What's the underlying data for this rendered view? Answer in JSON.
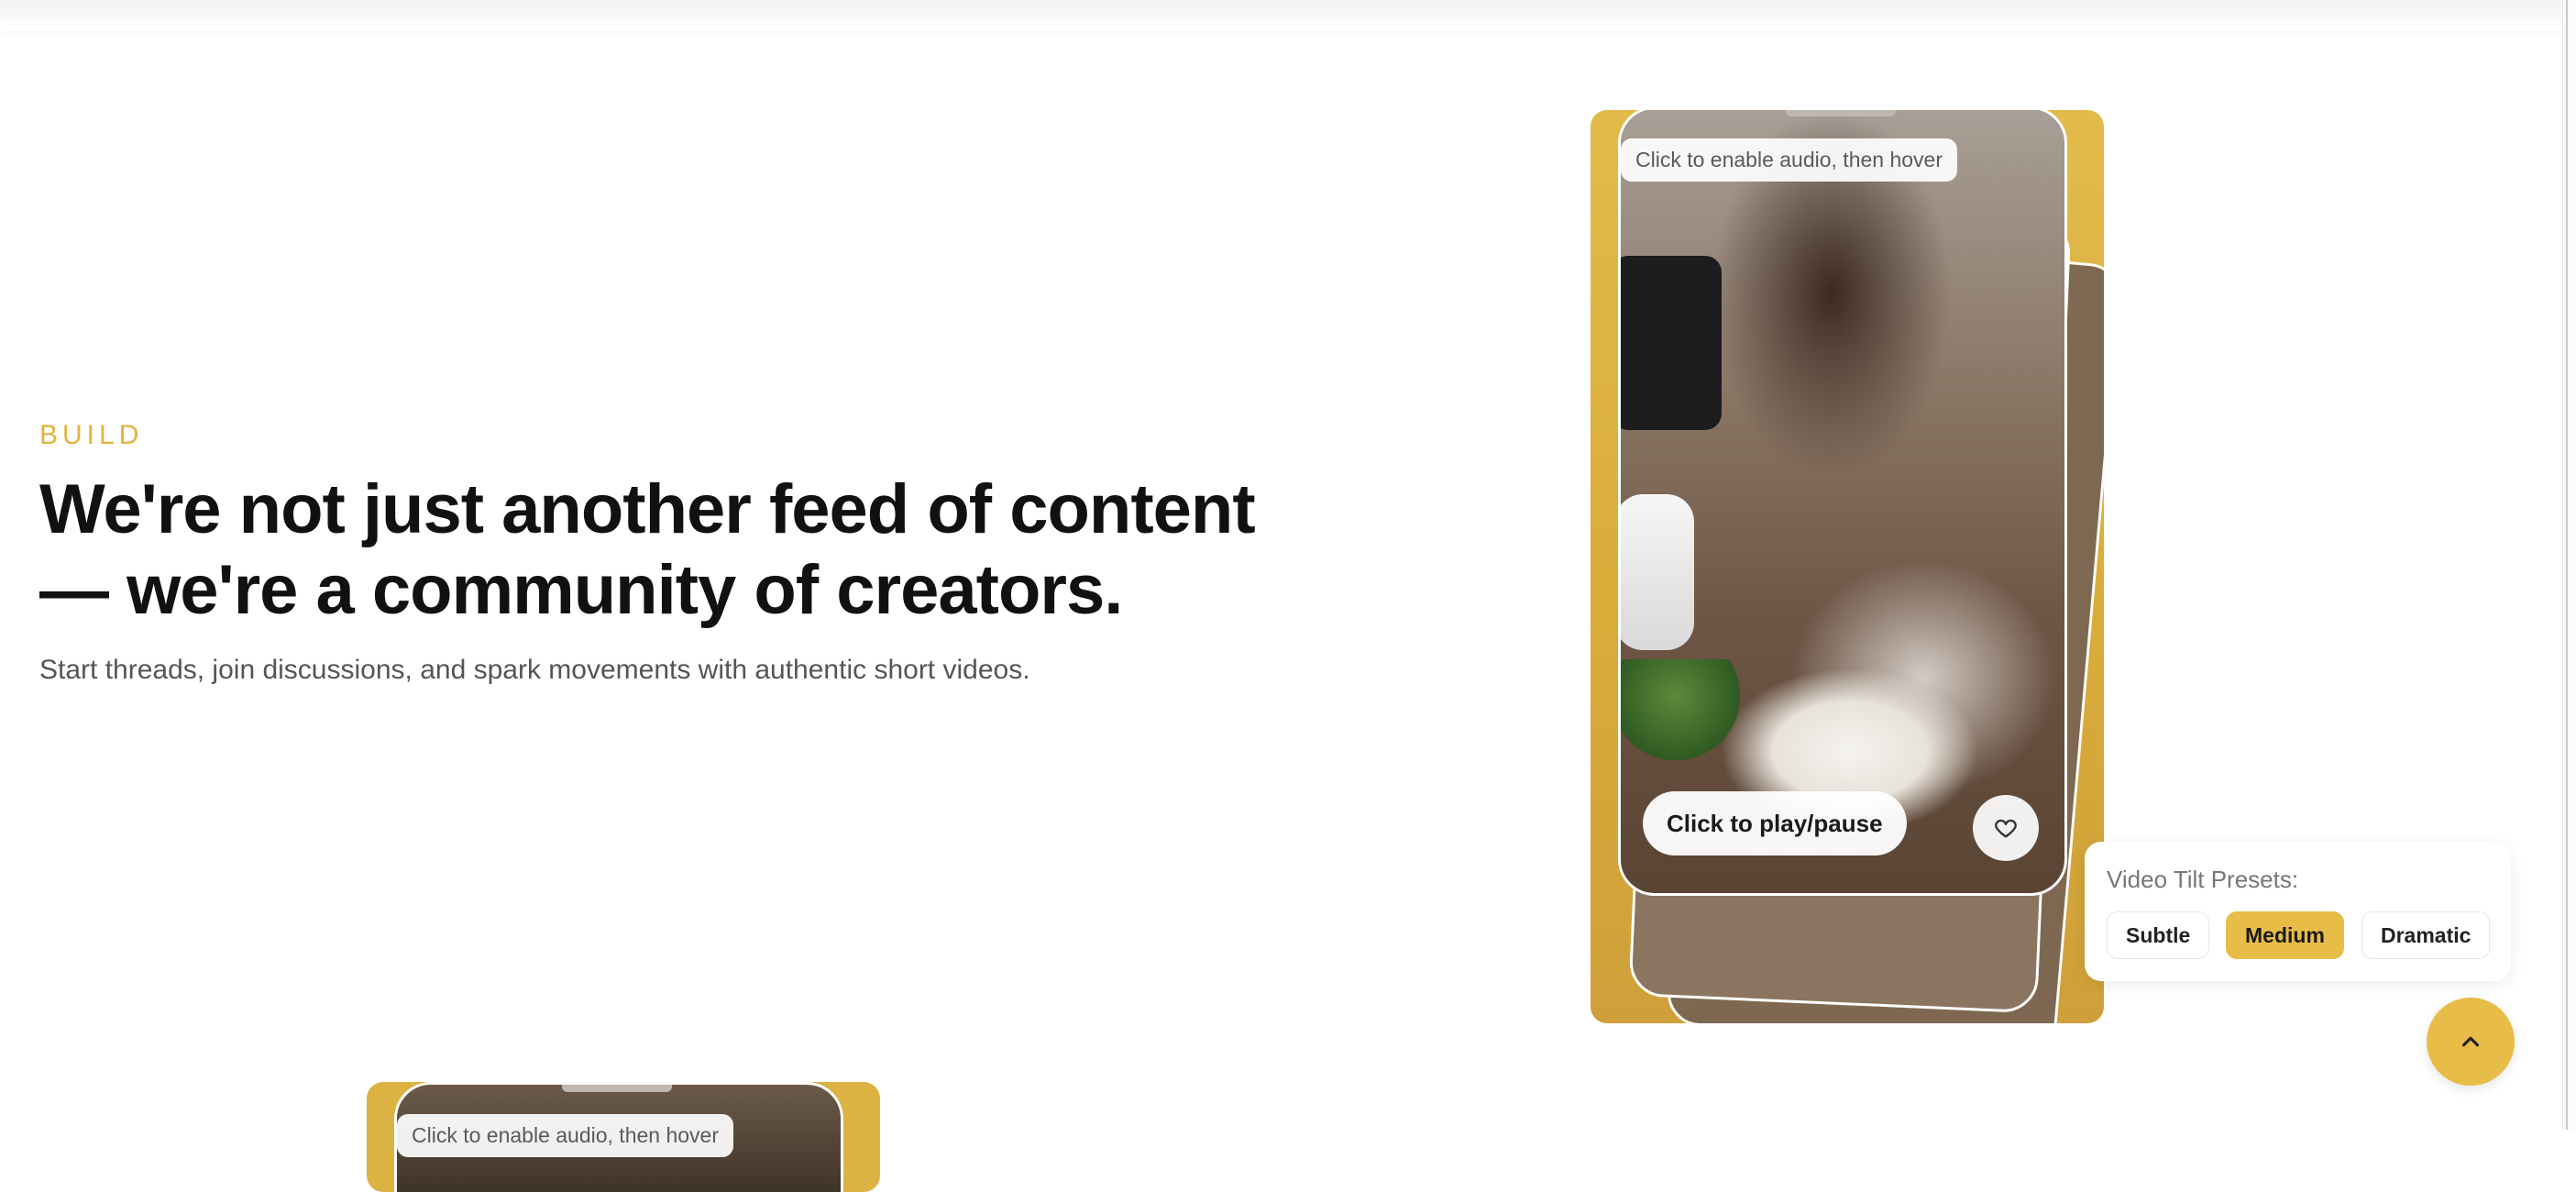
{
  "section": {
    "eyebrow": "BUILD",
    "headline": "We're not just another feed of content — we're a community of creators.",
    "subtext": "Start threads, join discussions, and spark movements with authentic short videos."
  },
  "video": {
    "audio_hint": "Click to enable audio, then hover",
    "play_label": "Click to play/pause",
    "like_icon": "heart-icon"
  },
  "presets": {
    "label": "Video Tilt Presets:",
    "options": [
      "Subtle",
      "Medium",
      "Dramatic"
    ],
    "selected": "Medium"
  },
  "scroll_top_icon": "chevron-up-icon",
  "colors": {
    "accent": "#e8bd47",
    "card": "#d9ac3a",
    "headline": "#111111",
    "subtext": "#555555"
  }
}
